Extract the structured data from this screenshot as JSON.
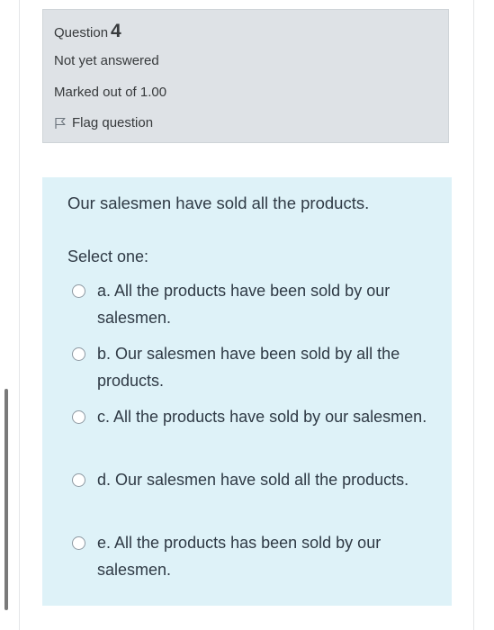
{
  "question": {
    "label": "Question",
    "number": "4",
    "state": "Not yet answered",
    "grade": "Marked out of 1.00",
    "flag_label": "Flag question"
  },
  "content": {
    "question_text": "Our salesmen have sold all the products.",
    "prompt": "Select one:",
    "options": [
      {
        "text": "a. All the products have been sold by our salesmen."
      },
      {
        "text": "b. Our salesmen have been sold by all the products."
      },
      {
        "text": "c. All the products have sold by our salesmen."
      },
      {
        "text": "d. Our salesmen have sold all the products."
      },
      {
        "text": "e. All the products has been sold by our salesmen."
      }
    ]
  },
  "icons": {
    "flag": "flag-icon",
    "radio": "radio-unselected-icon"
  },
  "colors": {
    "info_background": "#dee2e6",
    "content_background": "#def2f8",
    "text": "#2f3a45"
  }
}
